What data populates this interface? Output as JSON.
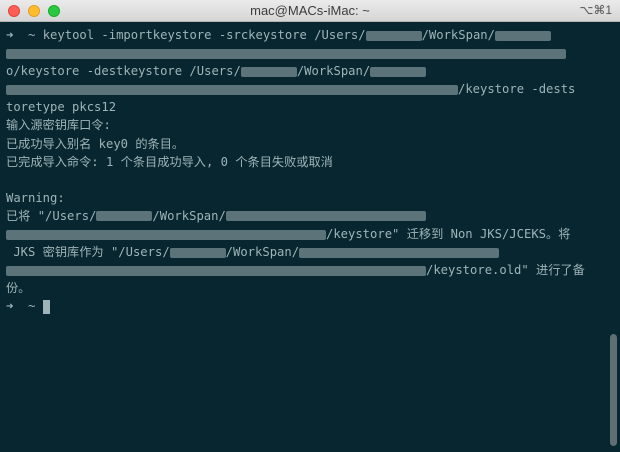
{
  "window": {
    "title": "mac@MACs-iMac: ~",
    "shortcut": "⌥⌘1"
  },
  "terminal": {
    "prompt_symbol": "➜",
    "home_symbol": "~",
    "lines": [
      "keytool -importkeystore -srckeystore /Users/",
      "/WorkSpan/",
      "o/keystore -destkeystore /Users/",
      "/WorkSpan/",
      "/keystore -dests",
      "toretype pkcs12",
      "输入源密钥库口令:",
      "已成功导入别名 key0 的条目。",
      "已完成导入命令: 1 个条目成功导入, 0 个条目失败或取消",
      "Warning:",
      "已将 \"/Users/",
      "/WorkSpan/",
      "/keystore\" 迁移到 Non JKS/JCEKS。将",
      " JKS 密钥库作为 \"/Users/",
      "/WorkSpan/",
      "/keystore.old\" 进行了备",
      "份。"
    ]
  }
}
